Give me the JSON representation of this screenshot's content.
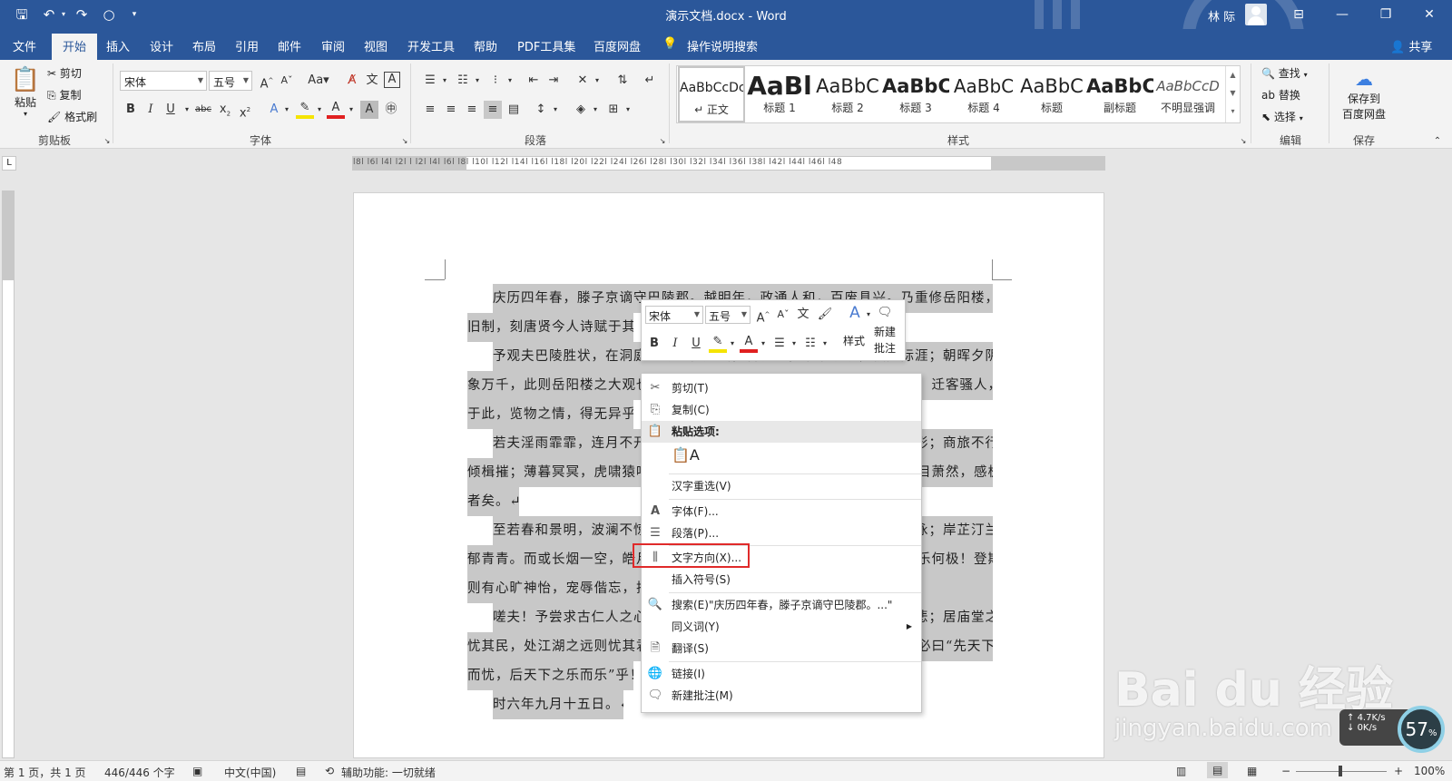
{
  "window": {
    "doc_title": "演示文档.docx - Word",
    "user_name": "林 际"
  },
  "tabs": [
    "文件",
    "开始",
    "插入",
    "设计",
    "布局",
    "引用",
    "邮件",
    "审阅",
    "视图",
    "开发工具",
    "帮助",
    "PDF工具集",
    "百度网盘"
  ],
  "tell_me": "操作说明搜索",
  "share": "共享",
  "ribbon": {
    "clipboard": {
      "paste": "粘贴",
      "cut": "剪切",
      "copy": "复制",
      "format_painter": "格式刷",
      "label": "剪贴板"
    },
    "font": {
      "name": "宋体",
      "size": "五号",
      "label": "字体"
    },
    "paragraph": {
      "label": "段落"
    },
    "styles": {
      "label": "样式",
      "items": [
        {
          "preview": "AaBbCcDc",
          "name": "↵ 正文"
        },
        {
          "preview": "AaBl",
          "name": "标题 1"
        },
        {
          "preview": "AaBbC",
          "name": "标题 2"
        },
        {
          "preview": "AaBbC",
          "name": "标题 3"
        },
        {
          "preview": "AaBbC",
          "name": "标题 4"
        },
        {
          "preview": "AaBbC",
          "name": "标题"
        },
        {
          "preview": "AaBbC",
          "name": "副标题"
        },
        {
          "preview": "AaBbCcD",
          "name": "不明显强调"
        }
      ]
    },
    "editing": {
      "find": "查找",
      "replace": "替换",
      "select": "选择",
      "label": "编辑"
    },
    "save": {
      "line1": "保存到",
      "line2": "百度网盘",
      "label": "保存"
    }
  },
  "ruler_numbers": "l8l l6l l4l l2l  l  l2l l4l l6l l8l l10l l12l l14l l16l l18l l20l l22l l24l l26l l28l l30l l32l l34l l36l l38l  l42l l44l l46l l48",
  "document": {
    "lines": [
      "庆历四年春，滕子京谪守巴陵郡。越明年，政通人和，百废具兴。乃重修岳阳楼，增其",
      "旧制，刻唐贤今人诗赋于其上",
      "予观夫巴陵胜状，在洞庭一湖。衔远山，吞长江，浩浩汤汤，横无际涯；朝晖夕阴，气",
      "象万千，此则岳阳楼之大观也，前人之述备矣。然则北通巫峡，南极潇湘，迁客骚人，多会",
      "于此，览物之情，得无异乎？",
      "若夫淫雨霏霏，连月不开，阴风怒号，浊浪排空；日星隐曜，山岳潜形；商旅不行，樯",
      "倾楫摧；薄暮冥冥，虎啸猿啼。登斯楼也，则有去国怀乡，忧谗畏讥，满目萧然，感极而悲",
      "者矣。↵",
      "至若春和景明，波澜不惊，上下天光，一碧万顷；沙鸥翔集，锦鳞游泳；岸芷汀兰，郁",
      "郁青青。而或长烟一空，皓月千里，浮光跃金，静影沉璧，渔歌互答，此乐何极！登斯楼也，",
      "则有心旷神怡，宠辱偕忘，把酒临风，其喜洋洋者矣。",
      "嗟夫！予尝求古仁人之心，或异二者之为，何哉？不以物喜，不以己悲；居庙堂之高则",
      "忧其民，处江湖之远则忧其君。是进亦忧，退亦忧。然则何时而乐耶？其必曰“先天下之忧",
      "而忧，后天下之乐而乐”乎！噫！微斯人，吾谁与归？",
      "时六年九月十五日。↵"
    ]
  },
  "mini_toolbar": {
    "font": "宋体",
    "size": "五号",
    "styles": "样式",
    "new_comment_1": "新建",
    "new_comment_2": "批注"
  },
  "context_menu": {
    "cut": "剪切(T)",
    "copy": "复制(C)",
    "paste_options": "粘贴选项:",
    "reconvert": "汉字重选(V)",
    "font": "字体(F)...",
    "paragraph": "段落(P)...",
    "text_direction": "文字方向(X)...",
    "insert_symbol": "插入符号(S)",
    "search": "搜索(E)\"庆历四年春，滕子京谪守巴陵郡。...\"",
    "synonyms": "同义词(Y)",
    "translate": "翻译(S)",
    "link": "链接(I)",
    "new_comment": "新建批注(M)"
  },
  "status": {
    "page": "第 1 页，共 1 页",
    "words": "446/446 个字",
    "language": "中文(中国)",
    "accessibility": "辅助功能: 一切就绪",
    "zoom": "100%"
  },
  "overlay": {
    "net_speed": "4.7K/s",
    "net_speed2": "0K/s",
    "percent": "57",
    "watermark1": "Bai du 经验",
    "watermark2": "jingyan.baidu.com"
  },
  "colors": {
    "brand": "#2b579a",
    "selection": "#c8c8c8",
    "highlight_box": "#e02a2a"
  }
}
